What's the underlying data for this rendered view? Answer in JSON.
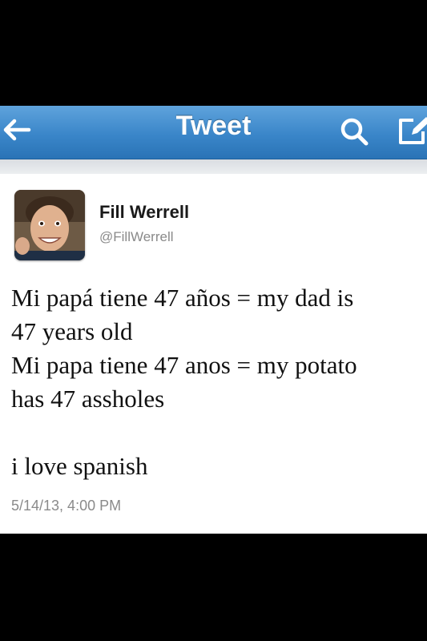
{
  "navbar": {
    "title": "Tweet",
    "back_icon": "back-arrow-icon",
    "search_icon": "search-icon",
    "compose_icon": "compose-icon"
  },
  "tweet": {
    "author_name": "Fill Werrell",
    "author_handle": "@FillWerrell",
    "lines": [
      "Mi papá tiene 47 años = my dad is",
      "47 years old",
      "Mi papa tiene 47 anos = my potato",
      "has 47 assholes",
      "",
      "i love spanish"
    ],
    "timestamp": "5/14/13, 4:00 PM"
  },
  "colors": {
    "navbar_blue": "#3a86c9",
    "background": "#000000",
    "card": "#ffffff",
    "meta_gray": "#8a8a8a"
  }
}
